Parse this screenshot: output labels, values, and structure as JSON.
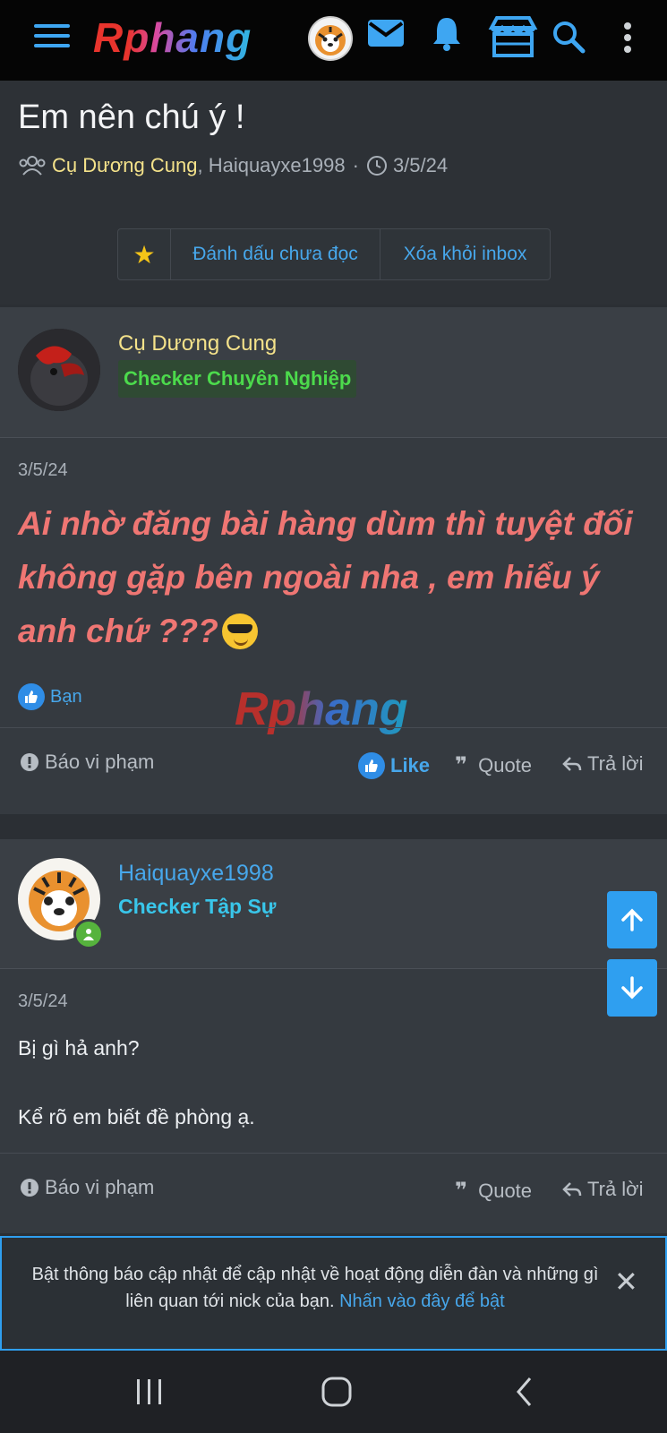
{
  "topbar": {
    "logo_text": "Rphang",
    "icons": [
      "menu-icon",
      "avatar",
      "mail-icon",
      "bell-icon",
      "store-icon",
      "search-icon",
      "more-icon"
    ]
  },
  "thread": {
    "title": "Em nên chú ý !",
    "participant_1": "Cụ Dương Cung",
    "participant_sep": ", ",
    "participant_2": "Haiquayxe1998",
    "dot": "·",
    "date": "3/5/24"
  },
  "buttons": {
    "mark_unread": "Đánh dấu chưa đọc",
    "remove_inbox": "Xóa khỏi inbox"
  },
  "messages": [
    {
      "username": "Cụ Dương Cung",
      "role": "Checker Chuyên Nghiệp",
      "date": "3/5/24",
      "body": "Ai nhờ đăng bài hàng dùm thì tuyệt đối không gặp bên ngoài nha , em hiểu ý anh chứ ???",
      "reaction_text": "Bạn",
      "actions": {
        "report": "Báo vi phạm",
        "like": "Like",
        "quote": "Quote",
        "reply": "Trả lời"
      }
    },
    {
      "username": "Haiquayxe1998",
      "role": "Checker Tập Sự",
      "date": "3/5/24",
      "line_1": "Bị gì hả anh?",
      "line_2": "Kể rõ em biết đề phòng ạ.",
      "actions": {
        "report": "Báo vi phạm",
        "quote": "Quote",
        "reply": "Trả lời"
      }
    }
  ],
  "watermark": "Rphang",
  "notice": {
    "text": "Bật thông báo cập nhật để cập nhật về hoạt động diễn đàn và những gì liên quan tới nick của bạn.",
    "link": "Nhấn vào đây để bật",
    "close": "✕"
  },
  "colors": {
    "accent": "#47a7eb",
    "username_gold": "#f4e28a",
    "role_green": "#4cda4c",
    "role_cyan": "#39c6ea",
    "post_red": "#ef7673"
  }
}
